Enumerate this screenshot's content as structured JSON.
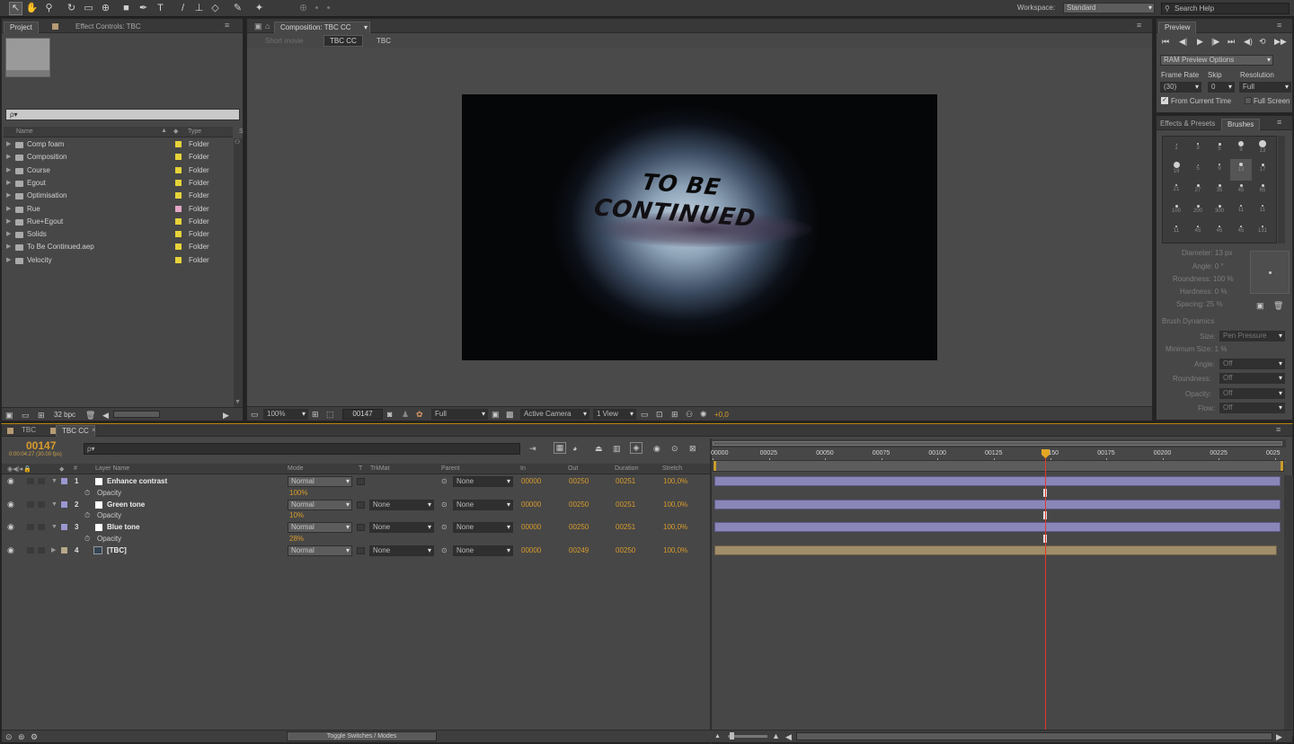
{
  "workspace": {
    "label": "Workspace:",
    "value": "Standard"
  },
  "search_help": {
    "placeholder": "Search Help"
  },
  "project_panel": {
    "tabs": [
      "Project",
      "Effect Controls: TBC"
    ],
    "search": "ρ▾",
    "columns": {
      "name": "Name",
      "type": "Type"
    },
    "items": [
      {
        "name": "Comp foam",
        "type": "Folder",
        "color": "#e6d33a"
      },
      {
        "name": "Composition",
        "type": "Folder",
        "color": "#e6d33a"
      },
      {
        "name": "Course",
        "type": "Folder",
        "color": "#e6d33a"
      },
      {
        "name": "Egout",
        "type": "Folder",
        "color": "#e6d33a"
      },
      {
        "name": "Optimisation",
        "type": "Folder",
        "color": "#e6d33a"
      },
      {
        "name": "Rue",
        "type": "Folder",
        "color": "#e4a7c6"
      },
      {
        "name": "Rue+Egout",
        "type": "Folder",
        "color": "#e6d33a"
      },
      {
        "name": "Solids",
        "type": "Folder",
        "color": "#e6d33a"
      },
      {
        "name": "To Be Continued.aep",
        "type": "Folder",
        "color": "#e6d33a"
      },
      {
        "name": "Velocity",
        "type": "Folder",
        "color": "#e6d33a"
      }
    ],
    "bpc": "32 bpc"
  },
  "composition_panel": {
    "tab": "Composition: TBC CC",
    "breadcrumbs": [
      "Short movie",
      "TBC CC",
      "TBC"
    ],
    "viewer_text_line1": "TO BE",
    "viewer_text_line2": "CONTINUED",
    "zoom": "100%",
    "timecode": "00147",
    "resolution": "Full",
    "camera": "Active Camera",
    "views": "1 View",
    "exposure": "+0,0"
  },
  "preview_panel": {
    "tab": "Preview",
    "ram_options": "RAM Preview Options",
    "frame_rate_label": "Frame Rate",
    "skip_label": "Skip",
    "resolution_label": "Resolution",
    "frame_rate": "(30)",
    "skip": "0",
    "resolution": "Full",
    "from_current_time": "From Current Time",
    "full_screen": "Full Screen"
  },
  "brushes_panel": {
    "tabs": [
      "Effects & Presets",
      "Brushes"
    ],
    "sizes": [
      "1",
      "3",
      "5",
      "9",
      "13",
      "19",
      "5",
      "9",
      "13",
      "17",
      "21",
      "27",
      "35",
      "45",
      "65",
      "100",
      "200",
      "300",
      "11",
      "11",
      "11",
      "45",
      "45",
      "45",
      "131"
    ],
    "diameter": "Diameter: 13 px",
    "angle": "Angle: 0 °",
    "roundness": "Roundness: 100 %",
    "hardness": "Hardness: 0 %",
    "spacing": "Spacing: 25 %",
    "dynamics_label": "Brush Dynamics",
    "size_label": "Size:",
    "size_value": "Pen Pressure",
    "min_size": "Minimum Size: 1 %",
    "angle_label": "Angle:",
    "roundness_label": "Roundness:",
    "opacity_label": "Opacity:",
    "flow_label": "Flow:",
    "off": "Off"
  },
  "timeline": {
    "tabs": [
      "TBC",
      "TBC CC"
    ],
    "current_time": "00147",
    "current_time_sub": "0:00:04:27 (30.00 fps)",
    "search": "ρ▾",
    "columns": {
      "layer_name": "Layer Name",
      "mode": "Mode",
      "t": "T",
      "trkmat": "TrkMat",
      "parent": "Parent",
      "in": "In",
      "out": "Out",
      "duration": "Duration",
      "stretch": "Stretch"
    },
    "ruler": [
      "00000",
      "00025",
      "00050",
      "00075",
      "00100",
      "00125",
      "00150",
      "00175",
      "00200",
      "00225",
      "0025"
    ],
    "layers": [
      {
        "num": "1",
        "name": "Enhance contrast",
        "mode": "Normal",
        "trkmat": "",
        "parent": "None",
        "in": "00000",
        "out": "00250",
        "duration": "00251",
        "stretch": "100,0%",
        "prop": "Opacity",
        "prop_value": "100%",
        "color": "#9a97d0"
      },
      {
        "num": "2",
        "name": "Green tone",
        "mode": "Normal",
        "trkmat": "None",
        "parent": "None",
        "in": "00000",
        "out": "00250",
        "duration": "00251",
        "stretch": "100,0%",
        "prop": "Opacity",
        "prop_value": "10%",
        "color": "#9a97d0"
      },
      {
        "num": "3",
        "name": "Blue tone",
        "mode": "Normal",
        "trkmat": "None",
        "parent": "None",
        "in": "00000",
        "out": "00250",
        "duration": "00251",
        "stretch": "100,0%",
        "prop": "Opacity",
        "prop_value": "28%",
        "color": "#9a97d0"
      },
      {
        "num": "4",
        "name": "[TBC]",
        "mode": "Normal",
        "trkmat": "None",
        "parent": "None",
        "in": "00000",
        "out": "00249",
        "duration": "00250",
        "stretch": "100,0%",
        "color": "#b7a88a"
      }
    ],
    "toggle_label": "Toggle Switches / Modes"
  },
  "colors": {
    "accent": "#d89b2b",
    "playhead": "#e23b2b",
    "layer_bar": "#8a87b8",
    "footage_bar": "#a08d6a"
  }
}
